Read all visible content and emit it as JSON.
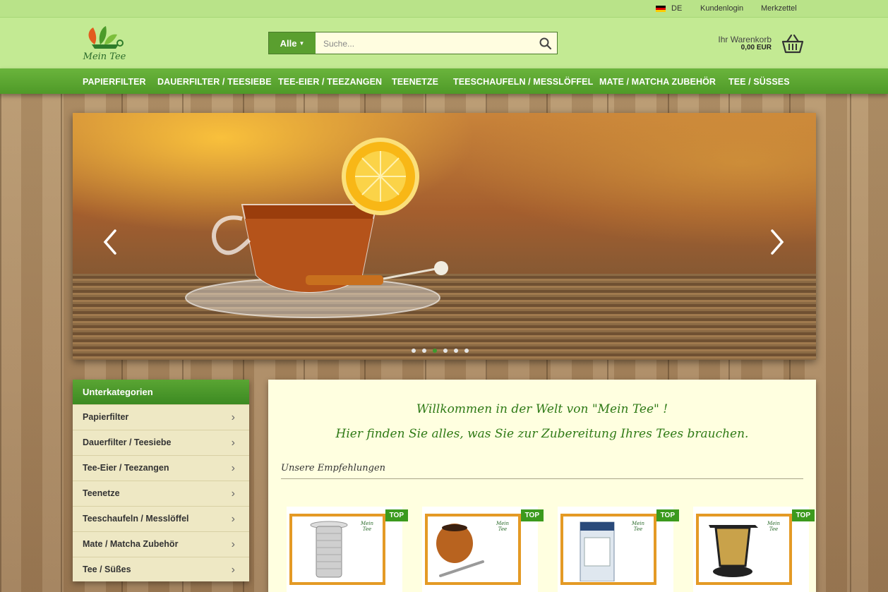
{
  "topbar": {
    "language": "DE",
    "login_label": "Kundenlogin",
    "wishlist_label": "Merkzettel"
  },
  "header": {
    "logo_text": "Mein Tee",
    "search": {
      "category_label": "Alle",
      "placeholder": "Suche..."
    },
    "cart": {
      "label": "Ihr Warenkorb",
      "total": "0,00 EUR"
    }
  },
  "nav": {
    "items": [
      "PAPIERFILTER",
      "DAUERFILTER / TEESIEBE",
      "TEE-EIER / TEEZANGEN",
      "TEENETZE",
      "TEESCHAUFELN / MESSLÖFFEL",
      "MATE / MATCHA ZUBEHÖR",
      "TEE / SÜSSES"
    ]
  },
  "slider": {
    "slide_count": 6,
    "active_slide": 3
  },
  "sidebar": {
    "title": "Unterkategorien",
    "items": [
      "Papierfilter",
      "Dauerfilter / Teesiebe",
      "Tee-Eier / Teezangen",
      "Teenetze",
      "Teeschaufeln / Messlöffel",
      "Mate / Matcha Zubehör",
      "Tee / Süßes"
    ]
  },
  "main": {
    "welcome_line1": "Willkommen in der Welt von \"Mein Tee\" !",
    "welcome_line2": "Hier finden Sie alles, was Sie zur Zubereitung Ihres Tees brauchen.",
    "recommendations_title": "Unsere Empfehlungen",
    "products": [
      {
        "badge": "TOP",
        "logo_text": "Mein Tee"
      },
      {
        "badge": "TOP",
        "logo_text": "Mein Tee"
      },
      {
        "badge": "TOP",
        "logo_text": "Mein Tee"
      },
      {
        "badge": "TOP",
        "logo_text": "Mein Tee"
      }
    ]
  },
  "colors": {
    "brand_green": "#4f9a28",
    "header_green": "#c3ea93",
    "accent_orange": "#e49a25",
    "panel_cream": "#ffffe0"
  }
}
